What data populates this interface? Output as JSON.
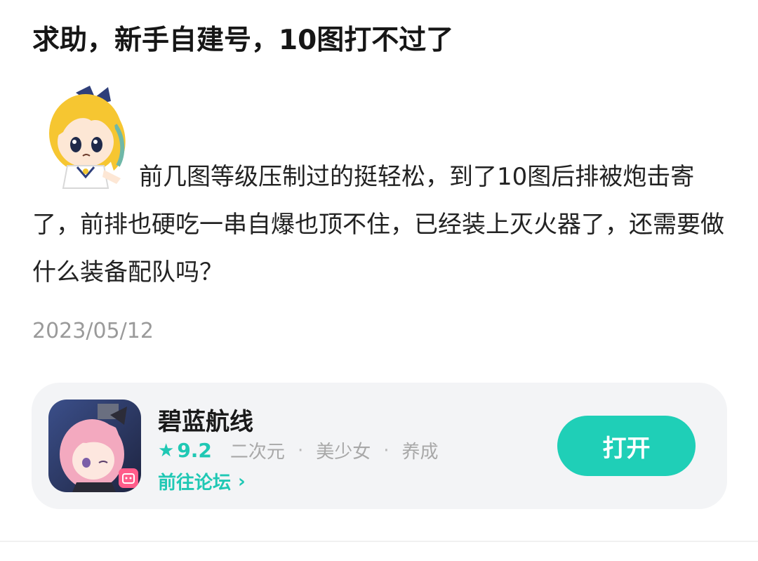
{
  "post": {
    "title": "求助，新手自建号，10图打不过了",
    "body": "前几图等级压制过的挺轻松，到了10图后排被炮击寄了，前排也硬吃一串自爆也顶不住，已经装上灭火器了，还需要做什么装备配队吗？",
    "date": "2023/05/12",
    "sticker_icon": "chibi-girl-sticker"
  },
  "game_card": {
    "name": "碧蓝航线",
    "star_icon": "★",
    "rating": "9.2",
    "tags": [
      "二次元",
      "美少女",
      "养成"
    ],
    "tag_separator": "·",
    "forum_link": "前往论坛",
    "forum_chevron": "›",
    "open_button": "打开",
    "accent_color": "#1fc8b4"
  }
}
